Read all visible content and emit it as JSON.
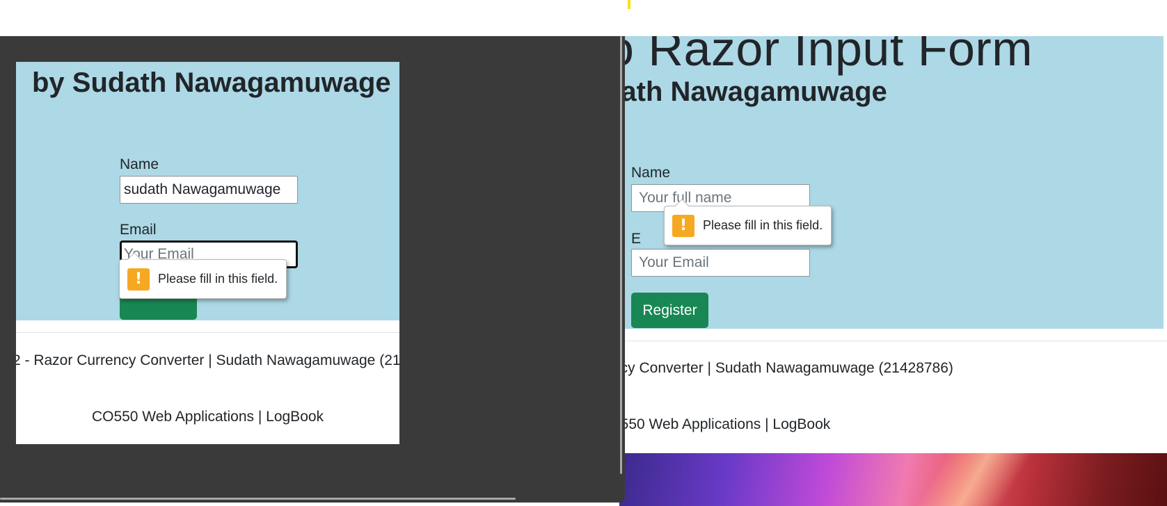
{
  "right_window": {
    "heading": "lo Razor Input Form",
    "subheading": "dath Nawagamuwage",
    "form": {
      "name_label": "Name",
      "name_placeholder": "Your full name",
      "email_label": "E",
      "email_placeholder": "Your Email",
      "register_label": "Register"
    },
    "tooltip": "Please fill in this field.",
    "footer_line1": "ncy Converter | Sudath Nawagamuwage (21428786)",
    "footer_line2": "0550 Web Applications | LogBook"
  },
  "left_window": {
    "subheading": "by Sudath Nawagamuwage",
    "form": {
      "name_label": "Name",
      "name_value": "sudath Nawagamuwage",
      "email_label": "Email",
      "email_placeholder": "Your Email"
    },
    "tooltip": "Please fill in this field.",
    "footer_line1": "2 - Razor Currency Converter | Sudath Nawagamuwage (21",
    "footer_line2": "CO550 Web Applications | LogBook"
  },
  "icons": {
    "warning": "warning-icon",
    "warning_glyph": "!"
  },
  "colors": {
    "banner": "#add8e6",
    "button": "#198754",
    "warning": "#f7a823",
    "window_dark": "#3a3a3a"
  }
}
